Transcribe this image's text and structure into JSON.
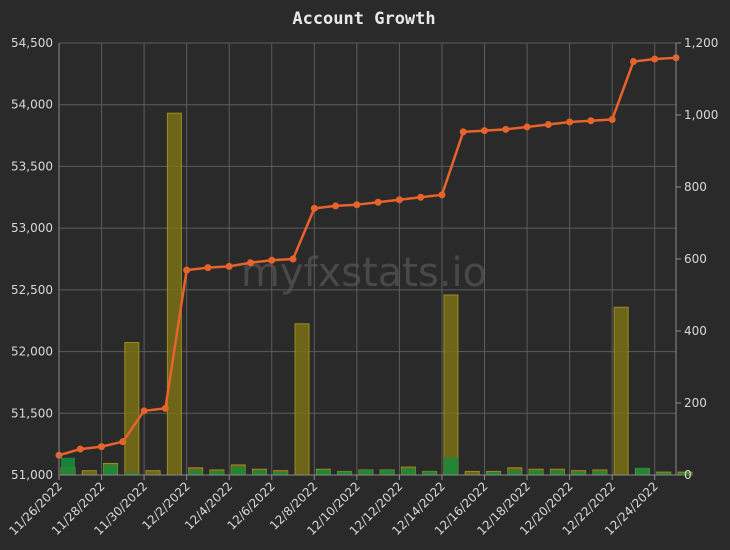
{
  "chart_data": {
    "type": "bar+line",
    "title": "Account Growth",
    "watermark": "myfxstats.io",
    "y_left_range": [
      51000,
      54500
    ],
    "y_left_ticks": [
      "51,000",
      "51,500",
      "52,000",
      "52,500",
      "53,000",
      "53,500",
      "54,000",
      "54,500"
    ],
    "y_right_range": [
      0,
      1200
    ],
    "y_right_ticks": [
      "0",
      "200",
      "400",
      "600",
      "800",
      "1,000",
      "1,200"
    ],
    "x_tick_labels": [
      "11/26/2022",
      "11/28/2022",
      "11/30/2022",
      "12/2/2022",
      "12/4/2022",
      "12/6/2022",
      "12/8/2022",
      "12/10/2022",
      "12/12/2022",
      "12/14/2022",
      "12/16/2022",
      "12/18/2022",
      "12/20/2022",
      "12/22/2022",
      "12/24/2022"
    ],
    "x_count": 30,
    "balance_line": {
      "color": "#e8632a",
      "values": [
        51160,
        51210,
        51230,
        51270,
        51520,
        51540,
        52660,
        52680,
        52690,
        52720,
        52740,
        52750,
        53160,
        53180,
        53190,
        53210,
        53230,
        53250,
        53270,
        53780,
        53790,
        53800,
        53820,
        53840,
        53860,
        53870,
        53880,
        54350,
        54370,
        54380
      ]
    },
    "gain_bars": {
      "color": "#1a8a3a",
      "values": [
        48,
        0,
        28,
        6,
        0,
        0,
        12,
        10,
        22,
        12,
        8,
        0,
        14,
        10,
        14,
        14,
        18,
        10,
        48,
        0,
        8,
        12,
        12,
        12,
        8,
        10,
        0,
        20,
        6,
        6
      ]
    },
    "volume_bars": {
      "color": "#7a7015",
      "values": [
        20,
        12,
        32,
        368,
        12,
        1005,
        20,
        14,
        28,
        16,
        12,
        420,
        16,
        10,
        14,
        14,
        22,
        10,
        500,
        10,
        10,
        20,
        16,
        16,
        12,
        14,
        466,
        18,
        8,
        8
      ]
    }
  }
}
